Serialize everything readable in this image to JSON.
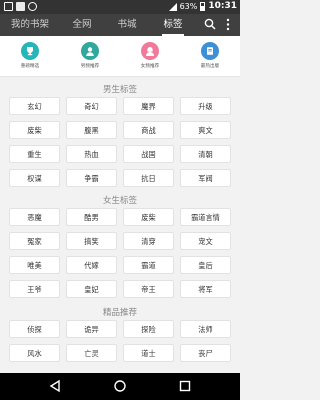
{
  "status": {
    "battery": "63%",
    "time": "10:31"
  },
  "nav": {
    "tabs": [
      {
        "label": "我的书架"
      },
      {
        "label": "全网"
      },
      {
        "label": "书城"
      },
      {
        "label": "标签"
      }
    ],
    "active_index": 3
  },
  "quick_links": [
    {
      "label": "重磅精选",
      "icon": "trophy-icon",
      "color": "#26b6b9"
    },
    {
      "label": "男频推荐",
      "icon": "male-avatar-icon",
      "color": "#31a89c"
    },
    {
      "label": "女频推荐",
      "icon": "female-avatar-icon",
      "color": "#f07a9a"
    },
    {
      "label": "最热出版",
      "icon": "book-icon",
      "color": "#3d8fd6"
    }
  ],
  "sections": [
    {
      "title": "男生标签",
      "tags": [
        "玄幻",
        "奇幻",
        "魔界",
        "升级",
        "废柴",
        "腹黑",
        "商战",
        "爽文",
        "重生",
        "热血",
        "战国",
        "清朝",
        "权谋",
        "争霸",
        "抗日",
        "军阀"
      ]
    },
    {
      "title": "女生标签",
      "tags": [
        "恶魔",
        "酷男",
        "废柴",
        "霸道言情",
        "冤家",
        "搞笑",
        "清穿",
        "宠文",
        "唯美",
        "代嫁",
        "霸道",
        "皇后",
        "王爷",
        "皇妃",
        "帝王",
        "将军"
      ]
    },
    {
      "title": "精品推荐",
      "tags": [
        "侦探",
        "诡异",
        "探险",
        "法师",
        "风水",
        "亡灵",
        "道士",
        "丧尸"
      ]
    }
  ],
  "colors": {
    "status_bar": "#333333",
    "top_nav": "#404040",
    "background": "#f2f2f2"
  }
}
